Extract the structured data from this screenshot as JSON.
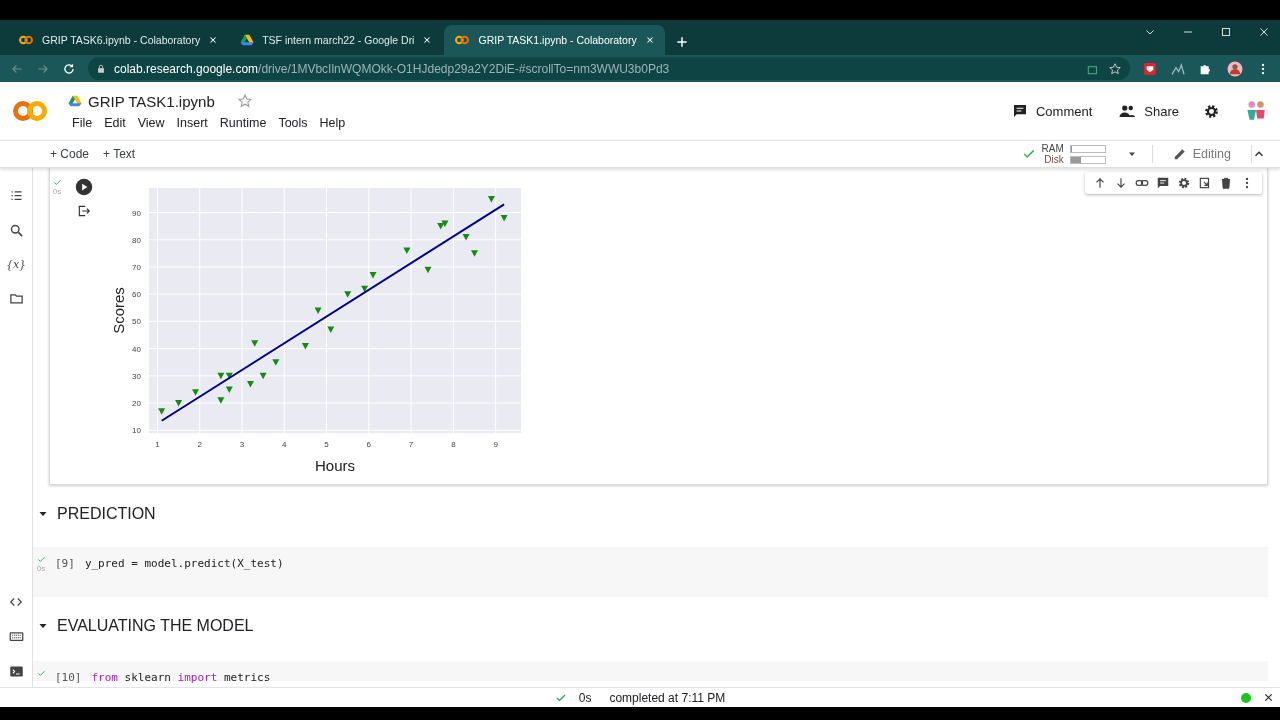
{
  "browser": {
    "tabs": [
      {
        "title": "GRIP TASK6.ipynb - Colaboratory",
        "kind": "colab",
        "selected": false
      },
      {
        "title": "TSF intern march22 - Google Dri",
        "kind": "drive",
        "selected": false
      },
      {
        "title": "GRIP TASK1.ipynb - Colaboratory",
        "kind": "colab",
        "selected": true
      }
    ],
    "url_host": "colab.research.google.com",
    "url_path": "/drive/1MVbcIlnWQMOkk-O1HJdedp29a2Y2DiE-#scrollTo=nm3WWU3b0Pd3"
  },
  "notebook": {
    "title": "GRIP TASK1.ipynb",
    "menu": [
      "File",
      "Edit",
      "View",
      "Insert",
      "Runtime",
      "Tools",
      "Help"
    ],
    "header_actions": [
      "Comment",
      "Share"
    ],
    "toolbar": {
      "add_buttons": [
        "+ Code",
        "+ Text"
      ],
      "ram_label": "RAM",
      "ram": {
        "level": 0.05
      },
      "disk_label": "Disk",
      "disk": {
        "level": 0.3
      },
      "mode": "Editing"
    },
    "sidebar_variables": "{x}"
  },
  "output_cell": {
    "exec_time": "0s",
    "chart_data": {
      "type": "scatter",
      "grid": true,
      "xlabel": "Hours",
      "ylabel": "Scores",
      "xlim": [
        0.8,
        9.6
      ],
      "ylim": [
        9,
        99
      ],
      "xticks": [
        1,
        2,
        3,
        4,
        5,
        6,
        7,
        8,
        9
      ],
      "yticks": [
        10,
        20,
        30,
        40,
        50,
        60,
        70,
        80,
        90
      ],
      "series": [
        {
          "type": "scatter",
          "color": "#148c14",
          "x": [
            1.1,
            1.5,
            1.9,
            2.5,
            2.5,
            2.7,
            2.7,
            3.2,
            3.3,
            3.5,
            3.8,
            4.5,
            4.8,
            5.1,
            5.5,
            5.9,
            6.1,
            6.9,
            7.4,
            7.7,
            7.8,
            8.3,
            8.5,
            8.9,
            9.2
          ],
          "values": [
            17,
            20,
            24,
            30,
            21,
            30,
            25,
            27,
            42,
            30,
            35,
            41,
            54,
            47,
            60,
            62,
            67,
            76,
            69,
            85,
            86,
            81,
            75,
            95,
            88
          ]
        },
        {
          "type": "line",
          "color": "#00008b",
          "x": [
            1.1,
            9.2
          ],
          "values": [
            13.5,
            93
          ]
        }
      ]
    }
  },
  "sections": [
    {
      "heading": "PREDICTION",
      "cell": {
        "count": "[9]",
        "exec_time": "0s",
        "tokens": [
          {
            "text": "y_pred = model.predict(X_test)",
            "kind": "plain"
          }
        ]
      }
    },
    {
      "heading": "EVALUATING THE MODEL",
      "cell": {
        "count": "[10]",
        "tokens": [
          {
            "text": "from",
            "kind": "keyword"
          },
          {
            "text": " sklearn ",
            "kind": "plain"
          },
          {
            "text": "import",
            "kind": "keyword"
          },
          {
            "text": " metrics",
            "kind": "plain"
          }
        ]
      }
    }
  ],
  "status_bar": {
    "duration": "0s",
    "message": "completed at 7:11 PM"
  }
}
